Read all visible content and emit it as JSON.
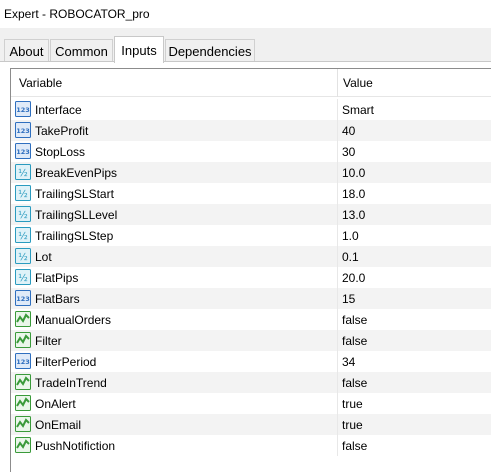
{
  "window": {
    "title": "Expert - ROBOCATOR_pro"
  },
  "tabs": [
    {
      "label": "About"
    },
    {
      "label": "Common"
    },
    {
      "label": "Inputs"
    },
    {
      "label": "Dependencies"
    }
  ],
  "table": {
    "columns": [
      "Variable",
      "Value"
    ],
    "rows": [
      {
        "name": "Interface",
        "value": "Smart",
        "type": "int"
      },
      {
        "name": "TakeProfit",
        "value": "40",
        "type": "int"
      },
      {
        "name": "StopLoss",
        "value": "30",
        "type": "int"
      },
      {
        "name": "BreakEvenPips",
        "value": "10.0",
        "type": "double"
      },
      {
        "name": "TrailingSLStart",
        "value": "18.0",
        "type": "double"
      },
      {
        "name": "TrailingSLLevel",
        "value": "13.0",
        "type": "double"
      },
      {
        "name": "TrailingSLStep",
        "value": "1.0",
        "type": "double"
      },
      {
        "name": "Lot",
        "value": "0.1",
        "type": "double"
      },
      {
        "name": "FlatPips",
        "value": "20.0",
        "type": "double"
      },
      {
        "name": "FlatBars",
        "value": "15",
        "type": "int"
      },
      {
        "name": "ManualOrders",
        "value": "false",
        "type": "bool"
      },
      {
        "name": "Filter",
        "value": "false",
        "type": "bool"
      },
      {
        "name": "FilterPeriod",
        "value": "34",
        "type": "int"
      },
      {
        "name": "TradeInTrend",
        "value": "false",
        "type": "bool"
      },
      {
        "name": "OnAlert",
        "value": "true",
        "type": "bool"
      },
      {
        "name": "OnEmail",
        "value": "true",
        "type": "bool"
      },
      {
        "name": "PushNotifiction",
        "value": "false",
        "type": "bool"
      }
    ]
  },
  "icons": {
    "int": {
      "name": "integer-type-icon",
      "text": "123",
      "color": "#2f6fbf"
    },
    "double": {
      "name": "double-type-icon",
      "text": "½",
      "color": "#2a9bbf"
    },
    "bool": {
      "name": "boolean-type-icon",
      "color": "#3a9a3a"
    }
  }
}
